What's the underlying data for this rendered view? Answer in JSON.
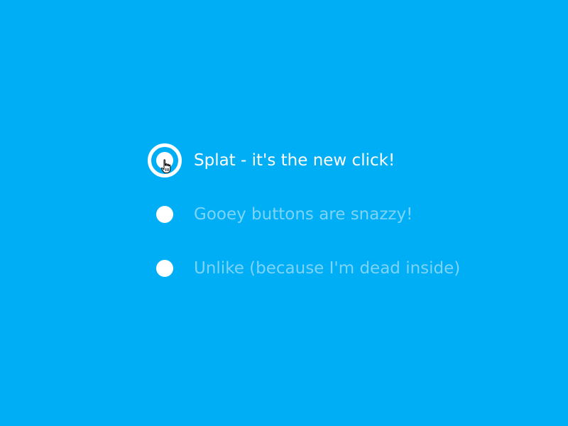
{
  "options": [
    {
      "label": "Splat - it's the new click!",
      "selected": true
    },
    {
      "label": "Gooey buttons are snazzy!",
      "selected": false
    },
    {
      "label": "Unlike (because I'm dead inside)",
      "selected": false
    }
  ],
  "colors": {
    "background": "#00AEF5",
    "radio": "#FFFFFF",
    "selected_text": "#FFFFFF",
    "unselected_text": "#7DD4F7"
  },
  "icons": {
    "cursor": "hand-pointer-icon"
  }
}
